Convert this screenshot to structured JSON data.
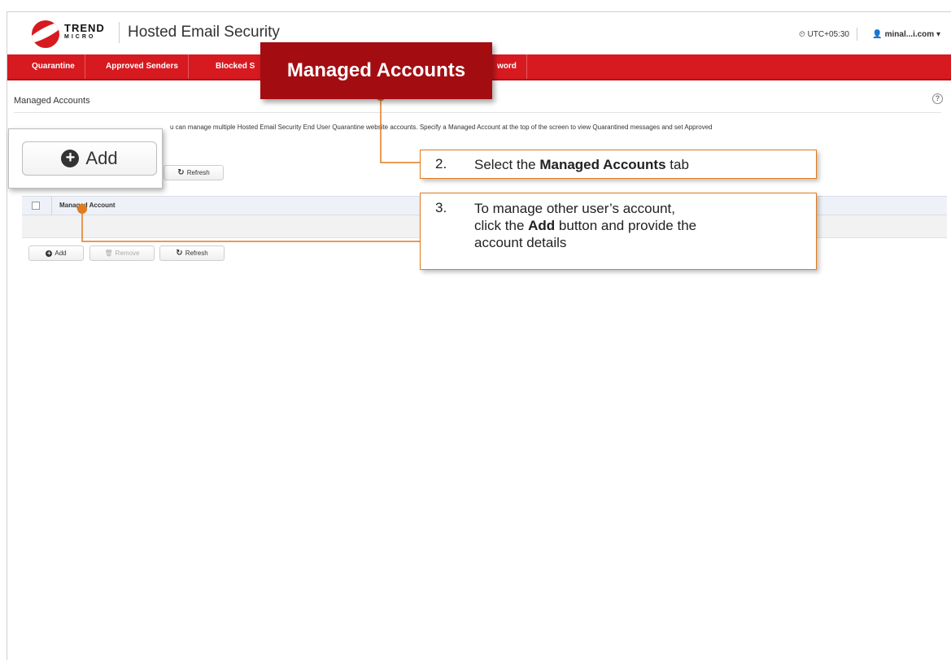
{
  "header": {
    "logo_line1": "TREND",
    "logo_line2": "MICRO",
    "product_name": "Hosted Email Security",
    "timezone": "UTC+05:30",
    "user": "minal...i.com"
  },
  "nav": {
    "tabs": [
      {
        "label": "Quarantine"
      },
      {
        "label": "Approved Senders"
      },
      {
        "label": "Blocked S"
      },
      {
        "label": "word"
      }
    ]
  },
  "page": {
    "title": "Managed Accounts",
    "description": "u can manage multiple Hosted Email Security End User Quarantine website accounts. Specify a Managed Account at the top of the screen to view Quarantined messages and set Approved"
  },
  "toolbar_top": {
    "refresh_label": "Refresh"
  },
  "table": {
    "column_header": "Managed Account"
  },
  "toolbar_bottom": {
    "add_label": "Add",
    "remove_label": "Remove",
    "refresh_label": "Refresh"
  },
  "callouts": {
    "zoom_add_label": "Add",
    "tab_callout_label": "Managed Accounts",
    "step2_number": "2.",
    "step2_pre": "Select the ",
    "step2_bold": "Managed Accounts",
    "step2_post": " tab",
    "step3_number": "3.",
    "step3_line1": "To manage other user’s account,",
    "step3_pre": "click the ",
    "step3_bold": "Add",
    "step3_post": " button and provide the",
    "step3_line3": "account details"
  },
  "colors": {
    "brand_red": "#d71920",
    "callout_dark_red": "#a30d12",
    "leader_orange": "#e07b1e"
  }
}
